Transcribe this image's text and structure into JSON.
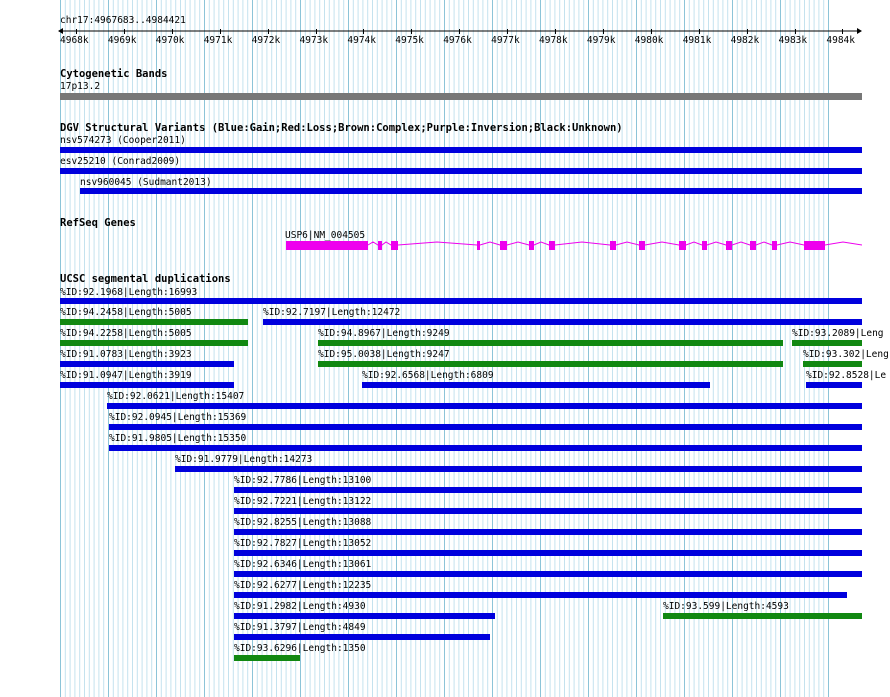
{
  "ruler": {
    "position": "chr17:4967683..4984421",
    "ticks": [
      "4968k",
      "4969k",
      "4970k",
      "4971k",
      "4972k",
      "4973k",
      "4974k",
      "4975k",
      "4976k",
      "4977k",
      "4978k",
      "4979k",
      "4980k",
      "4981k",
      "4982k",
      "4983k",
      "4984k"
    ]
  },
  "cytoband": {
    "title": "Cytogenetic Bands",
    "band": "17p13.2"
  },
  "dgv": {
    "title": "DGV Structural Variants (Blue:Gain;Red:Loss;Brown:Complex;Purple:Inversion;Black:Unknown)",
    "variants": [
      "nsv574273 (Cooper2011)",
      "esv25210 (Conrad2009)",
      "nsv960045 (Sudmant2013)"
    ]
  },
  "refseq": {
    "title": "RefSeq Genes",
    "gene": "USP6|NM_004505"
  },
  "segdup": {
    "title": "UCSC segmental duplications",
    "labels": [
      "%ID:92.1968|Length:16993",
      "%ID:94.2458|Length:5005",
      "%ID:92.7197|Length:12472",
      "%ID:94.2258|Length:5005",
      "%ID:94.8967|Length:9249",
      "%ID:93.2089|Leng",
      "%ID:91.0783|Length:3923",
      "%ID:95.0038|Length:9247",
      "%ID:93.302|Leng",
      "%ID:91.0947|Length:3919",
      "%ID:92.6568|Length:6809",
      "%ID:92.8528|Le",
      "%ID:92.0621|Length:15407",
      "%ID:92.0945|Length:15369",
      "%ID:91.9805|Length:15350",
      "%ID:91.9779|Length:14273",
      "%ID:92.7786|Length:13100",
      "%ID:92.7221|Length:13122",
      "%ID:92.8255|Length:13088",
      "%ID:92.7827|Length:13052",
      "%ID:92.6346|Length:13061",
      "%ID:92.6277|Length:12235",
      "%ID:91.2982|Length:4930",
      "%ID:93.599|Length:4593",
      "%ID:91.3797|Length:4849",
      "%ID:93.6296|Length:1350"
    ]
  },
  "colors": {
    "blue": "#0000dd",
    "green": "#118811",
    "magenta": "#ee00ee",
    "grey": "#777777",
    "grid": "#a8d4e4"
  }
}
